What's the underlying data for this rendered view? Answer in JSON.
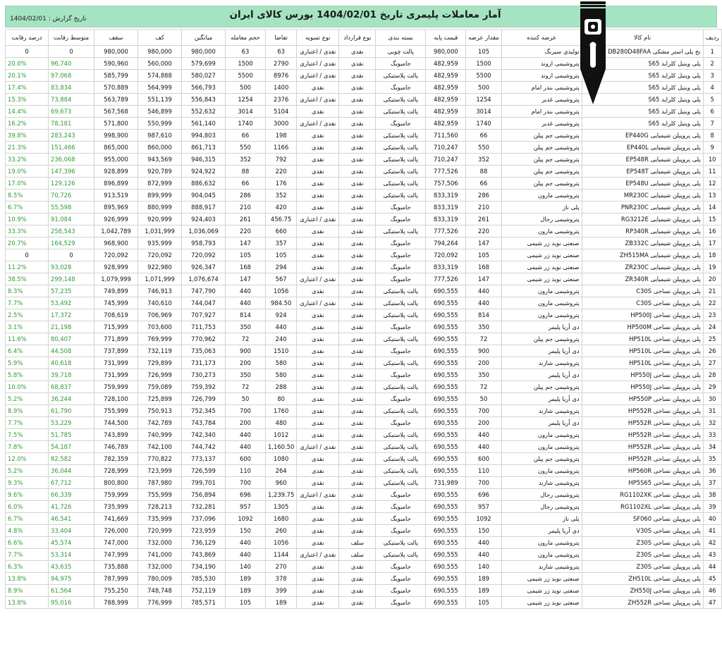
{
  "header": {
    "title": "آمار معاملات پلیمری تاریخ  1404/02/01  بورس کالای ایران",
    "report_date": "تاریخ گزارش : 1404/02/01"
  },
  "columns": [
    "ردیف",
    "نام کالا",
    "عرضه کننده",
    "مقدار عرضه",
    "قیمت پایه",
    "بسته بندی",
    "نوع قرارداد",
    "نوع تسویه",
    "تقاضا",
    "حجم معامله",
    "میانگین",
    "کف",
    "سقف",
    "متوسط رقابت",
    "درصد رقابت"
  ],
  "rows": [
    [
      "1",
      "نخ پلی استر مشکی DB280D48FAA",
      "تولیدی سیرنگ",
      "105",
      "980,000",
      "پالت چوبی",
      "نقدی",
      "نقدی / اعتباری",
      "63",
      "63",
      "980,000",
      "980,000",
      "980,000",
      "0",
      "0"
    ],
    [
      "2",
      "پلی وینیل کلراید S65",
      "پتروشیمی اروند",
      "1500",
      "482,959",
      "جامبوبگ",
      "نقدی",
      "نقدی / اعتباری",
      "2790",
      "1500",
      "579,699",
      "560,000",
      "590,960",
      "96,740",
      "20.0%"
    ],
    [
      "3",
      "پلی وینیل کلراید S65",
      "پتروشیمی اروند",
      "5500",
      "482,959",
      "پالت پلاستیکی",
      "نقدی",
      "نقدی / اعتباری",
      "8976",
      "5500",
      "580,027",
      "574,888",
      "585,799",
      "97,068",
      "20.1%"
    ],
    [
      "4",
      "پلی وینیل کلراید S65",
      "پتروشیمی بندر امام",
      "500",
      "482,959",
      "جامبوبگ",
      "نقدی",
      "نقدی",
      "1400",
      "500",
      "566,793",
      "564,999",
      "570,889",
      "83,834",
      "17.4%"
    ],
    [
      "5",
      "پلی وینیل کلراید S65",
      "پتروشیمی غدیر",
      "1254",
      "482,959",
      "پالت پلاستیکی",
      "نقدی",
      "نقدی / اعتباری",
      "2376",
      "1254",
      "556,843",
      "551,139",
      "563,789",
      "73,884",
      "15.3%"
    ],
    [
      "6",
      "پلی وینیل کلراید S65",
      "پتروشیمی بندر امام",
      "3014",
      "482,959",
      "پالت پلاستیکی",
      "نقدی",
      "نقدی",
      "5104",
      "3014",
      "552,632",
      "546,899",
      "567,568",
      "69,673",
      "14.4%"
    ],
    [
      "7",
      "پلی وینیل کلراید S65",
      "پتروشیمی غدیر",
      "1740",
      "482,959",
      "جامبوبگ",
      "نقدی",
      "نقدی / اعتباری",
      "3000",
      "1740",
      "561,140",
      "550,999",
      "571,800",
      "78,181",
      "16.2%"
    ],
    [
      "8",
      "پلی پروپیلن شیمیایی EP440G",
      "پتروشیمی جم پیلن",
      "66",
      "711,560",
      "پالت پلاستیکی",
      "نقدی",
      "نقدی",
      "198",
      "66",
      "994,803",
      "987,610",
      "998,900",
      "283,243",
      "39.8%"
    ],
    [
      "9",
      "پلی پروپیلن شیمیایی EP440L",
      "پتروشیمی جم پیلن",
      "550",
      "710,247",
      "پالت پلاستیکی",
      "نقدی",
      "نقدی",
      "1166",
      "550",
      "861,713",
      "860,000",
      "865,000",
      "151,466",
      "21.3%"
    ],
    [
      "10",
      "پلی پروپیلن شیمیایی EP548R",
      "پتروشیمی جم پیلن",
      "352",
      "710,247",
      "پالت پلاستیکی",
      "نقدی",
      "نقدی",
      "792",
      "352",
      "946,315",
      "943,569",
      "955,000",
      "236,068",
      "33.2%"
    ],
    [
      "11",
      "پلی پروپیلن شیمیایی EP548T",
      "پتروشیمی جم پیلن",
      "88",
      "777,526",
      "پالت پلاستیکی",
      "نقدی",
      "نقدی",
      "220",
      "88",
      "924,922",
      "920,789",
      "928,899",
      "147,396",
      "19.0%"
    ],
    [
      "12",
      "پلی پروپیلن شیمیایی EP548U",
      "پتروشیمی جم پیلن",
      "66",
      "757,506",
      "پالت پلاستیکی",
      "نقدی",
      "نقدی",
      "176",
      "66",
      "886,632",
      "872,999",
      "896,899",
      "129,126",
      "17.0%"
    ],
    [
      "13",
      "پلی پروپیلن شیمیایی MR230C",
      "پتروشیمی مارون",
      "286",
      "833,319",
      "پالت پلاستیکی",
      "نقدی",
      "نقدی",
      "352",
      "286",
      "904,045",
      "899,999",
      "913,519",
      "70,726",
      "8.5%"
    ],
    [
      "14",
      "پلی پروپیلن شیمیایی PNR230C",
      "پلی ناز",
      "210",
      "833,319",
      "جامبوبگ",
      "نقدی",
      "نقدی",
      "420",
      "210",
      "888,917",
      "880,999",
      "895,969",
      "55,598",
      "6.7%"
    ],
    [
      "15",
      "پلی پروپیلن شیمیایی RG3212E",
      "پتروشیمی رجال",
      "261",
      "833,319",
      "جامبوبگ",
      "نقدی",
      "نقدی / اعتباری",
      "456.75",
      "261",
      "924,403",
      "920,999",
      "926,999",
      "91,084",
      "10.9%"
    ],
    [
      "16",
      "پلی پروپیلن شیمیایی RP340R",
      "پتروشیمی مارون",
      "220",
      "777,526",
      "پالت پلاستیکی",
      "نقدی",
      "نقدی",
      "660",
      "220",
      "1,036,069",
      "1,031,999",
      "1,042,789",
      "258,543",
      "33.3%"
    ],
    [
      "17",
      "پلی پروپیلن شیمیایی ZB332C",
      "صنعتی نوید زر شیمی",
      "147",
      "794,264",
      "جامبوبگ",
      "نقدی",
      "نقدی",
      "357",
      "147",
      "958,793",
      "935,999",
      "968,900",
      "164,529",
      "20.7%"
    ],
    [
      "18",
      "پلی پروپیلن شیمیایی ZH515MA",
      "صنعتی نوید زر شیمی",
      "105",
      "720,092",
      "جامبوبگ",
      "نقدی",
      "نقدی",
      "105",
      "105",
      "720,092",
      "720,092",
      "720,092",
      "0",
      "0"
    ],
    [
      "19",
      "پلی پروپیلن شیمیایی ZR230C",
      "صنعتی نوید زر شیمی",
      "168",
      "833,319",
      "جامبوبگ",
      "نقدی",
      "نقدی",
      "294",
      "168",
      "926,347",
      "922,980",
      "928,999",
      "93,028",
      "11.2%"
    ],
    [
      "20",
      "پلی پروپیلن شیمیایی ZR340R",
      "صنعتی نوید زر شیمی",
      "147",
      "777,526",
      "جامبوبگ",
      "نقدی",
      "نقدی / اعتباری",
      "567",
      "147",
      "1,076,674",
      "1,071,999",
      "1,079,999",
      "299,148",
      "38.5%"
    ],
    [
      "21",
      "پلی پروپیلن نساجی C30S",
      "پتروشیمی مارون",
      "440",
      "690,555",
      "پالت پلاستیکی",
      "نقدی",
      "نقدی",
      "1056",
      "440",
      "747,790",
      "746,913",
      "749,899",
      "57,235",
      "8.3%"
    ],
    [
      "22",
      "پلی پروپیلن نساجی C30S",
      "پتروشیمی مارون",
      "440",
      "690,555",
      "پالت پلاستیکی",
      "نقدی",
      "نقدی / اعتباری",
      "984.50",
      "440",
      "744,047",
      "740,610",
      "745,999",
      "53,492",
      "7.7%"
    ],
    [
      "23",
      "پلی پروپیلن نساجی HP500J",
      "پتروشیمی مارون",
      "814",
      "690,555",
      "پالت پلاستیکی",
      "نقدی",
      "نقدی",
      "924",
      "814",
      "707,927",
      "706,969",
      "708,619",
      "17,372",
      "2.5%"
    ],
    [
      "24",
      "پلی پروپیلن نساجی HP500M",
      "دی آریا پلیمر",
      "350",
      "690,555",
      "جامبوبگ",
      "نقدی",
      "نقدی",
      "440",
      "350",
      "711,753",
      "703,600",
      "715,999",
      "21,198",
      "3.1%"
    ],
    [
      "25",
      "پلی پروپیلن نساجی HP510L",
      "پتروشیمی جم پیلن",
      "72",
      "690,555",
      "پالت پلاستیکی",
      "نقدی",
      "نقدی",
      "240",
      "72",
      "770,962",
      "769,999",
      "771,899",
      "80,407",
      "11.6%"
    ],
    [
      "26",
      "پلی پروپیلن نساجی HP510L",
      "دی آریا پلیمر",
      "900",
      "690,555",
      "جامبوبگ",
      "نقدی",
      "نقدی",
      "1510",
      "900",
      "735,063",
      "732,119",
      "737,899",
      "44,508",
      "6.4%"
    ],
    [
      "27",
      "پلی پروپیلن نساجی HP510L",
      "پتروشیمی شازند",
      "200",
      "690,555",
      "پالت پلاستیکی",
      "نقدی",
      "نقدی",
      "580",
      "200",
      "731,173",
      "729,899",
      "731,999",
      "40,618",
      "5.9%"
    ],
    [
      "28",
      "پلی پروپیلن نساجی HP550J",
      "دی آریا پلیمر",
      "350",
      "690,555",
      "جامبوبگ",
      "نقدی",
      "نقدی",
      "580",
      "350",
      "730,273",
      "726,999",
      "731,999",
      "39,718",
      "5.8%"
    ],
    [
      "29",
      "پلی پروپیلن نساجی HP550J",
      "پتروشیمی جم پیلن",
      "72",
      "690,555",
      "پالت پلاستیکی",
      "نقدی",
      "نقدی",
      "288",
      "72",
      "759,392",
      "759,089",
      "759,999",
      "68,837",
      "10.0%"
    ],
    [
      "30",
      "پلی پروپیلن نساجی HP550P",
      "دی آریا پلیمر",
      "50",
      "690,555",
      "جامبوبگ",
      "نقدی",
      "نقدی",
      "80",
      "50",
      "726,799",
      "725,899",
      "728,100",
      "36,244",
      "5.2%"
    ],
    [
      "31",
      "پلی پروپیلن نساجی HP552R",
      "پتروشیمی شازند",
      "700",
      "690,555",
      "پالت پلاستیکی",
      "نقدی",
      "نقدی",
      "1760",
      "700",
      "752,345",
      "750,913",
      "755,999",
      "61,790",
      "8.9%"
    ],
    [
      "32",
      "پلی پروپیلن نساجی HP552R",
      "دی آریا پلیمر",
      "200",
      "690,555",
      "جامبوبگ",
      "نقدی",
      "نقدی",
      "480",
      "200",
      "743,784",
      "742,789",
      "744,500",
      "53,229",
      "7.7%"
    ],
    [
      "33",
      "پلی پروپیلن نساجی HP552R",
      "پتروشیمی مارون",
      "440",
      "690,555",
      "پالت پلاستیکی",
      "نقدی",
      "نقدی",
      "1012",
      "440",
      "742,340",
      "740,999",
      "743,899",
      "51,785",
      "7.5%"
    ],
    [
      "34",
      "پلی پروپیلن نساجی HP552R",
      "پتروشیمی مارون",
      "440",
      "690,555",
      "پالت پلاستیکی",
      "نقدی",
      "نقدی / اعتباری",
      "1,160.50",
      "440",
      "744,742",
      "742,100",
      "746,789",
      "54,187",
      "7.8%"
    ],
    [
      "35",
      "پلی پروپیلن نساجی HP552R",
      "پتروشیمی جم پیلن",
      "600",
      "690,555",
      "پالت پلاستیکی",
      "نقدی",
      "نقدی",
      "1080",
      "600",
      "773,137",
      "770,822",
      "782,359",
      "82,582",
      "12.0%"
    ],
    [
      "36",
      "پلی پروپیلن نساجی HP560R",
      "پتروشیمی مارون",
      "110",
      "690,555",
      "پالت پلاستیکی",
      "نقدی",
      "نقدی",
      "264",
      "110",
      "726,599",
      "723,999",
      "728,999",
      "36,044",
      "5.2%"
    ],
    [
      "37",
      "پلی پروپیلن نساجی HP5S65",
      "پتروشیمی شازند",
      "700",
      "731,989",
      "پالت پلاستیکی",
      "نقدی",
      "نقدی",
      "960",
      "700",
      "799,701",
      "787,980",
      "800,800",
      "67,712",
      "9.3%"
    ],
    [
      "38",
      "پلی پروپیلن نساجی RG1102XK",
      "پتروشیمی رجال",
      "696",
      "690,555",
      "جامبوبگ",
      "نقدی",
      "نقدی / اعتباری",
      "1,239.75",
      "696",
      "756,894",
      "755,999",
      "759,999",
      "66,339",
      "9.6%"
    ],
    [
      "39",
      "پلی پروپیلن نساجی RG1102XL",
      "پتروشیمی رجال",
      "957",
      "690,555",
      "جامبوبگ",
      "نقدی",
      "نقدی",
      "1305",
      "957",
      "732,281",
      "728,213",
      "735,999",
      "41,726",
      "6.0%"
    ],
    [
      "40",
      "پلی پروپیلن نساجی SF060",
      "پلی ناز",
      "1092",
      "690,555",
      "جامبوبگ",
      "نقدی",
      "نقدی",
      "1680",
      "1092",
      "737,096",
      "735,999",
      "741,669",
      "46,541",
      "6.7%"
    ],
    [
      "41",
      "پلی پروپیلن نساجی V30S",
      "دی آریا پلیمر",
      "150",
      "690,555",
      "جامبوبگ",
      "نقدی",
      "نقدی",
      "260",
      "150",
      "723,959",
      "720,999",
      "726,000",
      "33,404",
      "4.8%"
    ],
    [
      "42",
      "پلی پروپیلن نساجی Z30S",
      "پتروشیمی مارون",
      "440",
      "690,555",
      "پالت پلاستیکی",
      "سلف",
      "نقدی",
      "1056",
      "440",
      "736,129",
      "732,000",
      "747,000",
      "45,574",
      "6.6%"
    ],
    [
      "43",
      "پلی پروپیلن نساجی Z30S",
      "پتروشیمی مارون",
      "440",
      "690,555",
      "پالت پلاستیکی",
      "سلف",
      "نقدی / اعتباری",
      "1144",
      "440",
      "743,869",
      "741,000",
      "747,999",
      "53,314",
      "7.7%"
    ],
    [
      "44",
      "پلی پروپیلن نساجی Z30S",
      "پتروشیمی شازند",
      "140",
      "690,555",
      "جامبوبگ",
      "نقدی",
      "نقدی",
      "270",
      "140",
      "734,190",
      "732,000",
      "735,888",
      "43,635",
      "6.3%"
    ],
    [
      "45",
      "پلی پروپیلن نساجی ZH510L",
      "صنعتی نوید زر شیمی",
      "189",
      "690,555",
      "جامبوبگ",
      "نقدی",
      "نقدی",
      "378",
      "189",
      "785,530",
      "780,009",
      "787,999",
      "94,975",
      "13.8%"
    ],
    [
      "46",
      "پلی پروپیلن نساجی ZH550J",
      "صنعتی نوید زر شیمی",
      "189",
      "690,555",
      "جامبوبگ",
      "نقدی",
      "نقدی",
      "399",
      "189",
      "752,119",
      "748,748",
      "755,250",
      "61,564",
      "8.9%"
    ],
    [
      "47",
      "پلی پروپیلن نساجی ZH552R",
      "صنعتی نوید زر شیمی",
      "105",
      "690,555",
      "جامبوبگ",
      "نقدی",
      "نقدی",
      "189",
      "105",
      "785,571",
      "776,999",
      "788,999",
      "95,016",
      "13.8%"
    ]
  ],
  "colors": {
    "header_bg": "#a6e3c3",
    "competition_green": "#2e9b32",
    "logo_black": "#111111"
  }
}
